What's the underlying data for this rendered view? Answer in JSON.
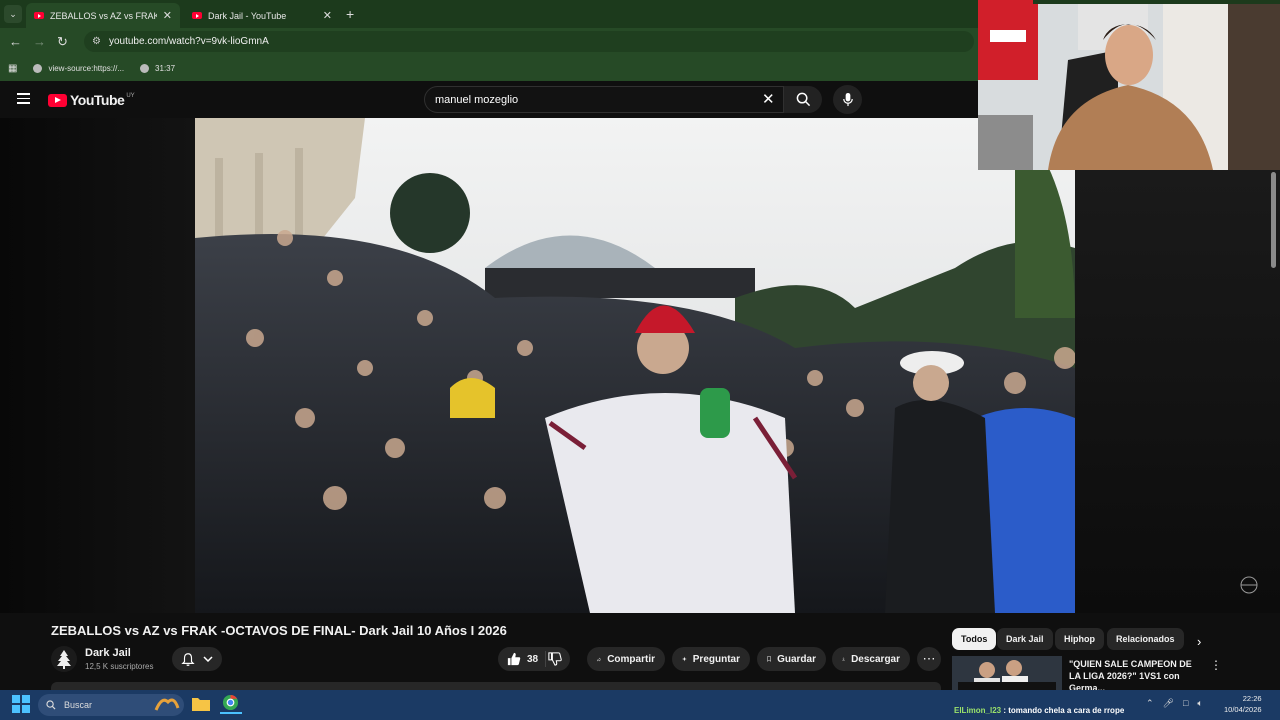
{
  "browser": {
    "tabs": [
      {
        "title": "ZEBALLOS vs AZ vs FRAK -OCTAVOS DE FINAL- Dark Jail 10 Años I 2026",
        "active": true
      },
      {
        "title": "Dark Jail - YouTube",
        "active": false
      }
    ],
    "url": "youtube.com/watch?v=9vk-lioGmnA",
    "bookmarks": [
      {
        "label": "view-source:https://..."
      },
      {
        "label": "31:37"
      }
    ]
  },
  "youtube": {
    "logo_text": "YouTube",
    "country_code": "UY",
    "search_value": "manuel mozeglio"
  },
  "video": {
    "title": "ZEBALLOS vs AZ vs FRAK -OCTAVOS DE FINAL- Dark Jail 10 Años I 2026",
    "channel_name": "Dark Jail",
    "subscribers": "12,5 K suscriptores",
    "likes": "38",
    "actions": {
      "share": "Compartir",
      "ask": "Preguntar",
      "save": "Guardar",
      "download": "Descargar"
    }
  },
  "sidebar": {
    "chips": [
      "Todos",
      "Dark Jail",
      "Hiphop",
      "Relacionados"
    ],
    "recommendation": {
      "title": "\"QUIEN SALE CAMPEON DE LA LIGA 2026?\" 1VS1 con Germa..."
    }
  },
  "taskbar": {
    "search_placeholder": "Buscar",
    "chat_user": "ElLimon_l23",
    "chat_message": " : tomando chela a cara de rrope",
    "time": "22:26",
    "date": "10/04/2026"
  },
  "colors": {
    "youtube_red": "#ff0033",
    "browser_green": "#264a26",
    "taskbar_blue": "#1b3a64"
  }
}
